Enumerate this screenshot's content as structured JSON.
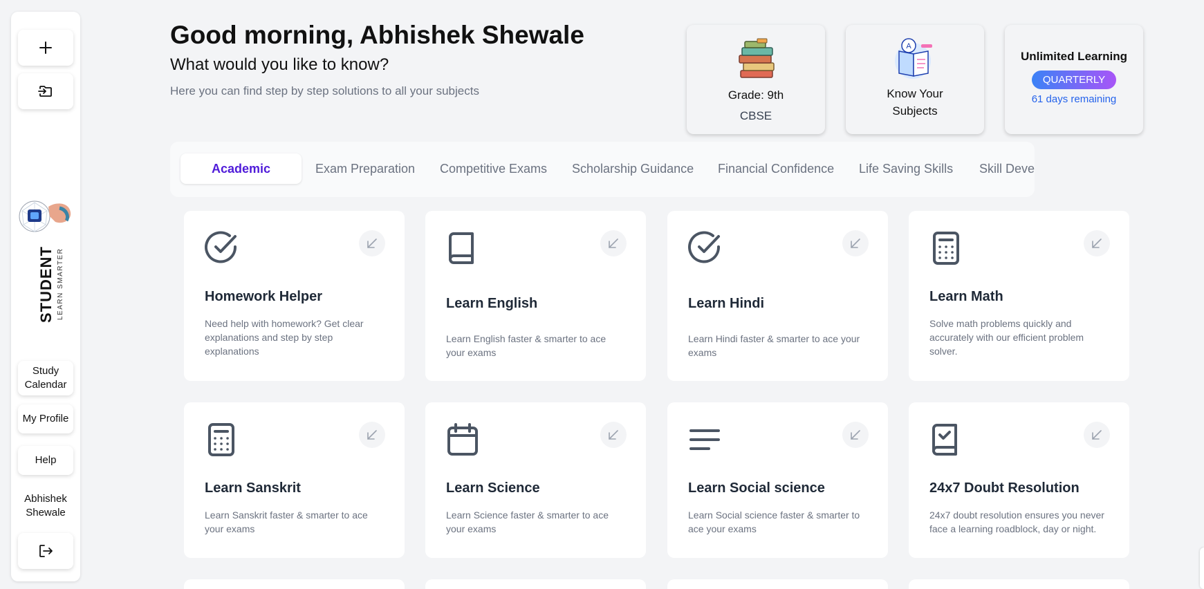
{
  "sidebar": {
    "new_icon": "plus-icon",
    "import_icon": "folder-import-icon",
    "logo": {
      "main": "STUDENT",
      "sub": "LEARN SMARTER"
    },
    "study_calendar": "Study Calendar",
    "my_profile": "My Profile",
    "help": "Help",
    "user_name": "Abhishek Shewale",
    "logout_icon": "logout-icon"
  },
  "header": {
    "greeting": "Good morning, Abhishek Shewale",
    "subtitle": "What would you like to know?",
    "description": "Here you can find step by step solutions to all your subjects"
  },
  "info_cards": {
    "grade": {
      "label": "Grade: 9th",
      "board": "CBSE",
      "icon": "books-stack-icon"
    },
    "subjects": {
      "line1": "Know Your",
      "line2": "Subjects",
      "icon": "open-book-icon"
    },
    "plan": {
      "title": "Unlimited Learning",
      "badge": "QUARTERLY",
      "remaining": "61 days remaining"
    }
  },
  "tabs": [
    {
      "label": "Academic",
      "active": true
    },
    {
      "label": "Exam Preparation"
    },
    {
      "label": "Competitive Exams"
    },
    {
      "label": "Scholarship Guidance"
    },
    {
      "label": "Financial Confidence"
    },
    {
      "label": "Life Saving Skills"
    },
    {
      "label": "Skill Deve"
    }
  ],
  "cards": [
    {
      "title": "Homework Helper",
      "desc": "Need help with homework? Get clear explanations and step by step explanations",
      "icon": "check-circle-icon"
    },
    {
      "title": "Learn English",
      "desc": "Learn English faster & smarter to ace your exams",
      "icon": "book-icon"
    },
    {
      "title": "Learn Hindi",
      "desc": "Learn Hindi faster & smarter to ace your exams",
      "icon": "check-circle-icon"
    },
    {
      "title": "Learn Math",
      "desc": "Solve math problems quickly and accurately with our efficient problem solver.",
      "icon": "calculator-icon"
    },
    {
      "title": "Learn Sanskrit",
      "desc": "Learn Sanskrit faster & smarter to ace your exams",
      "icon": "calculator-icon"
    },
    {
      "title": "Learn Science",
      "desc": "Learn Science faster & smarter to ace your exams",
      "icon": "calendar-icon"
    },
    {
      "title": "Learn Social science",
      "desc": "Learn Social science faster & smarter to ace your exams",
      "icon": "text-align-icon"
    },
    {
      "title": "24x7 Doubt Resolution",
      "desc": "24x7 doubt resolution ensures you never face a learning roadblock, day or night.",
      "icon": "book-check-icon"
    }
  ],
  "colors": {
    "accent": "#4f1bd9",
    "badge_start": "#3b82f6",
    "badge_end": "#a855f7",
    "link": "#2563eb"
  }
}
